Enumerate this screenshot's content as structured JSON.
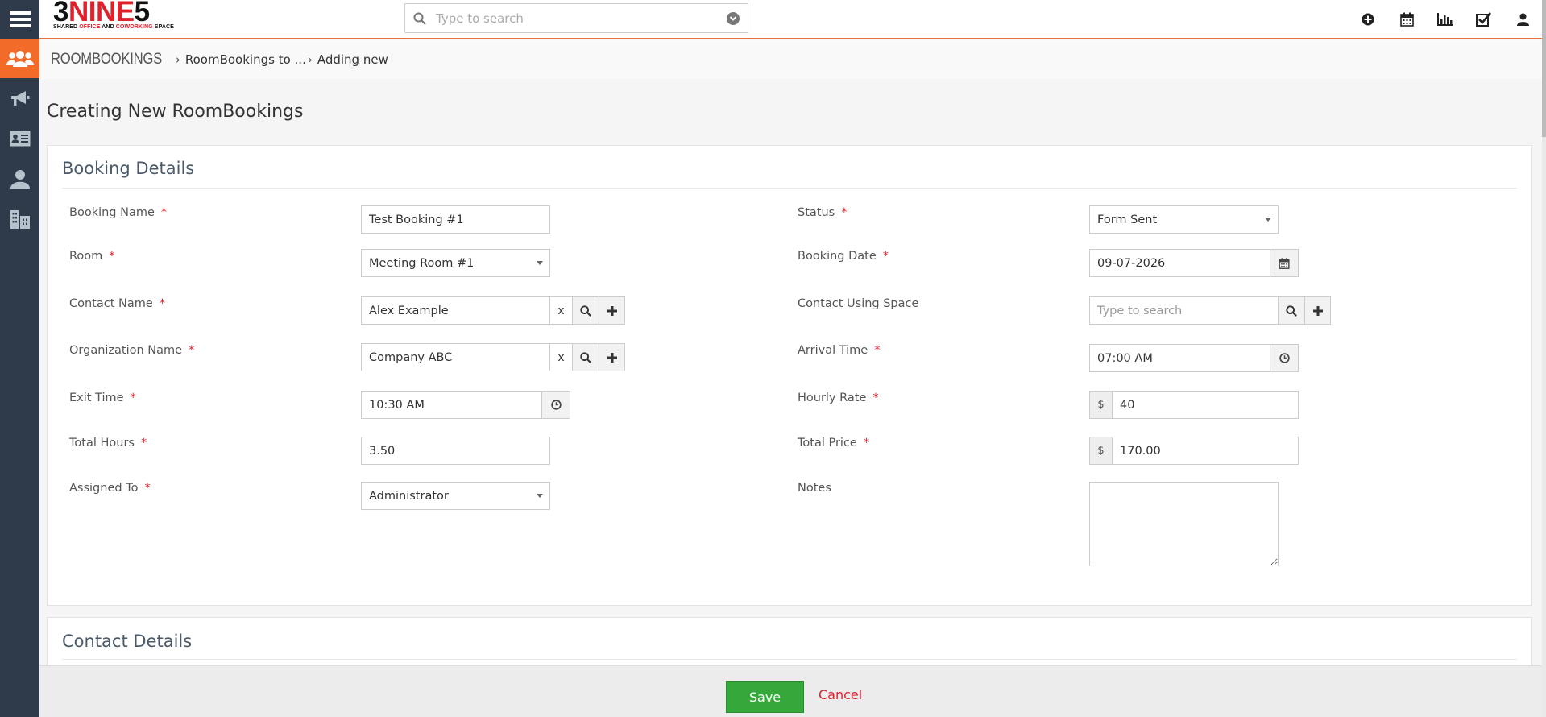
{
  "app": {
    "logo_main_dark": "3",
    "logo_main_red": "NINE",
    "logo_main_end": "5",
    "logo_sub_a": "SHARED ",
    "logo_sub_b": "OFFICE",
    "logo_sub_c": " AND ",
    "logo_sub_d": "COWORKING",
    "logo_sub_e": " SPACE"
  },
  "search": {
    "placeholder": "Type to search"
  },
  "top_icons": [
    "plus-circle-icon",
    "calendar-icon",
    "bar-chart-icon",
    "checkbox-icon",
    "user-icon"
  ],
  "rail_icons": [
    "users-icon",
    "megaphone-icon",
    "address-card-icon",
    "person-icon",
    "building-icon"
  ],
  "breadcrumb": {
    "module": "ROOMBOOKINGS",
    "parent": "RoomBookings to ...",
    "current": "Adding new"
  },
  "page": {
    "title": "Creating New RoomBookings"
  },
  "booking_details": {
    "title": "Booking Details",
    "booking_name": {
      "label": "Booking Name",
      "value": "Test Booking #1"
    },
    "room": {
      "label": "Room",
      "value": "Meeting Room #1"
    },
    "contact_name": {
      "label": "Contact Name",
      "value": "Alex Example",
      "clear": "x"
    },
    "organization_name": {
      "label": "Organization Name",
      "value": "Company ABC",
      "clear": "x"
    },
    "exit_time": {
      "label": "Exit Time",
      "value": "10:30 AM"
    },
    "total_hours": {
      "label": "Total Hours",
      "value": "3.50"
    },
    "assigned_to": {
      "label": "Assigned To",
      "value": "Administrator"
    },
    "status": {
      "label": "Status",
      "value": "Form Sent"
    },
    "booking_date": {
      "label": "Booking Date",
      "value": "09-07-2026"
    },
    "contact_using_space": {
      "label": "Contact Using Space",
      "placeholder": "Type to search"
    },
    "arrival_time": {
      "label": "Arrival Time",
      "value": "07:00 AM"
    },
    "hourly_rate": {
      "label": "Hourly Rate",
      "currency": "$",
      "value": "40"
    },
    "total_price": {
      "label": "Total Price",
      "currency": "$",
      "value": "170.00"
    },
    "notes": {
      "label": "Notes",
      "value": ""
    },
    "required_mark": "*"
  },
  "contact_details": {
    "title": "Contact Details"
  },
  "footer": {
    "save": "Save",
    "cancel": "Cancel"
  },
  "colors": {
    "accent": "#f26b28",
    "rail": "#2f3b4a",
    "save": "#36a83b",
    "required": "#e0212b"
  }
}
